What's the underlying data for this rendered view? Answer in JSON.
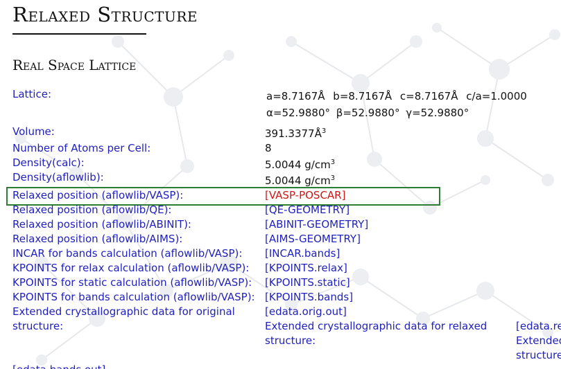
{
  "page": {
    "title": "Relaxed Structure",
    "subtitle": "Real Space Lattice"
  },
  "lattice": {
    "label": "Lattice:",
    "a": "a=8.7167Å",
    "b": "b=8.7167Å",
    "c": "c=8.7167Å",
    "c_over_a": "c/a=1.0000",
    "alpha": "α=52.9880°",
    "beta": "β=52.9880°",
    "gamma": "γ=52.9880°"
  },
  "volume": {
    "label": "Volume:",
    "value": "391.3377Å",
    "sup": "3"
  },
  "atoms": {
    "label": "Number of Atoms per Cell:",
    "value": "8"
  },
  "density_calc": {
    "label": "Density(calc):",
    "value": "5.0044 g/cm",
    "sup": "3"
  },
  "density_aflowlib": {
    "label": "Density(aflowlib):",
    "value": "5.0044 g/cm",
    "sup": "3"
  },
  "files": [
    {
      "label": "Relaxed position (aflowlib/VASP):",
      "link": "VASP-POSCAR"
    },
    {
      "label": "Relaxed position (aflowlib/QE):",
      "link": "QE-GEOMETRY"
    },
    {
      "label": "Relaxed position (aflowlib/ABINIT):",
      "link": "ABINIT-GEOMETRY"
    },
    {
      "label": "Relaxed position (aflowlib/AIMS):",
      "link": "AIMS-GEOMETRY"
    },
    {
      "label": "INCAR for bands calculation (aflowlib/VASP):",
      "link": "INCAR.bands"
    },
    {
      "label": "KPOINTS for relax calculation (aflowlib/VASP):",
      "link": "KPOINTS.relax"
    },
    {
      "label": "KPOINTS for static calculation (aflowlib/VASP):",
      "link": "KPOINTS.static"
    },
    {
      "label": "KPOINTS for bands calculation (aflowlib/VASP):",
      "link": "KPOINTS.bands"
    }
  ],
  "extended": {
    "orig_label": "Extended crystallographic data for original structure:",
    "orig_link": "edata.orig.out",
    "relaxed_label": "Extended crystallographic data for relaxed structure:",
    "relaxed_link": "edata.re",
    "col4_text": "Extended structure",
    "bands_link": "edata.bands.out"
  },
  "colors": {
    "link_blue": "#1f1fbf",
    "highlight_red": "#d21414",
    "box_green": "#2e7d32"
  }
}
